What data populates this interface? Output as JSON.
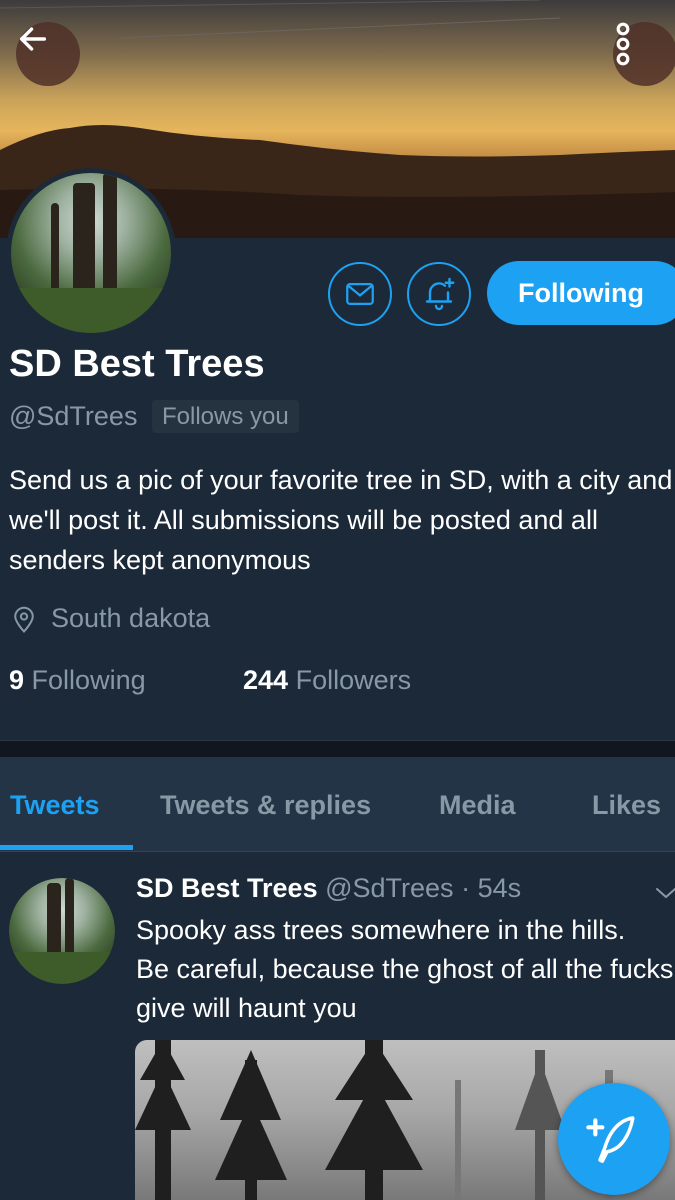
{
  "header": {
    "back_icon": "arrow-left-icon",
    "more_icon": "vertical-dots-icon"
  },
  "profile": {
    "name": "SD Best Trees",
    "handle": "@SdTrees",
    "follows_you": "Follows you",
    "bio": "Send us a pic of your favorite tree in SD, with a city and we'll post it. All submissions will be posted and all senders kept anonymous",
    "location": "South dakota",
    "following_count": "9",
    "following_label": "Following",
    "followers_count": "244",
    "followers_label": "Followers"
  },
  "actions": {
    "message_icon": "mail-icon",
    "notify_icon": "bell-plus-icon",
    "follow_button_label": "Following"
  },
  "tabs": [
    {
      "label": "Tweets",
      "active": true
    },
    {
      "label": "Tweets & replies",
      "active": false
    },
    {
      "label": "Media",
      "active": false
    },
    {
      "label": "Likes",
      "active": false
    }
  ],
  "tweet": {
    "author_name": "SD Best Trees",
    "author_handle": "@SdTrees",
    "separator": "·",
    "time": "54s",
    "text": "Spooky ass trees somewhere in the hills.\nBe careful, because the ghost of all the fucks I give will haunt you"
  },
  "compose_icon": "compose-feather-icon",
  "colors": {
    "accent": "#1da1f2",
    "background": "#1c2938",
    "secondary_text": "#8899a6"
  }
}
